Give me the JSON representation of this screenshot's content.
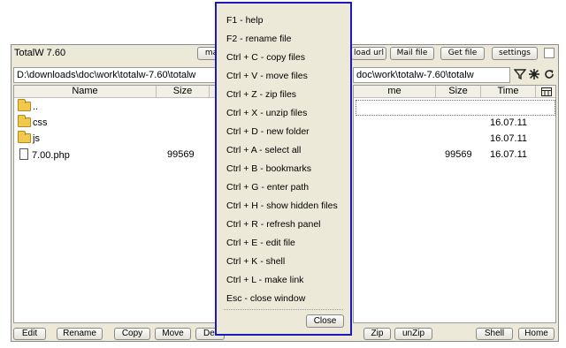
{
  "app": {
    "title": "TotalW 7.60"
  },
  "toolbar": {
    "partial_left": "ma",
    "download_url": "load url",
    "mail_file": "Mail file",
    "get_file": "Get file",
    "settings": "settings"
  },
  "left_panel": {
    "path": "D:\\downloads\\doc\\work\\totalw-7.60\\totalw",
    "columns": {
      "name": "Name",
      "size": "Size"
    },
    "rows": [
      {
        "name": "..",
        "type": "folder",
        "size": ""
      },
      {
        "name": "css",
        "type": "folder",
        "size": ""
      },
      {
        "name": "js",
        "type": "folder",
        "size": ""
      },
      {
        "name": "7.00.php",
        "type": "file",
        "size": "99569"
      }
    ]
  },
  "right_panel": {
    "path": "doc\\work\\totalw-7.60\\totalw",
    "columns": {
      "name": "me",
      "size": "Size",
      "time": "Time"
    },
    "rows": [
      {
        "size": "",
        "time": "16.07.11"
      },
      {
        "size": "",
        "time": "16.07.11"
      },
      {
        "size": "99569",
        "time": "16.07.11"
      }
    ]
  },
  "bottombar": {
    "edit": "Edit",
    "rename": "Rename",
    "copy": "Copy",
    "move": "Move",
    "delete_partial": "Del",
    "zip": "Zip",
    "unzip": "unZip",
    "shell": "Shell",
    "home": "Home"
  },
  "help_popup": {
    "items": [
      "F1 - help",
      "F2 - rename file",
      "Ctrl + C - copy files",
      "Ctrl + V - move files",
      "Ctrl + Z - zip files",
      "Ctrl + X - unzip files",
      "Ctrl + D - new folder",
      "Ctrl + A - select all",
      "Ctrl + B - bookmarks",
      "Ctrl + G - enter path",
      "Ctrl + H - show hidden files",
      "Ctrl + R - refresh panel",
      "Ctrl + E - edit file",
      "Ctrl + K - shell",
      "Ctrl + L - make link",
      "Esc - close window"
    ],
    "close_label": "Close"
  },
  "icons": {
    "filter": "filter-icon",
    "settings": "gear-icon",
    "refresh": "refresh-icon",
    "table": "table-icon"
  },
  "colors": {
    "popup_border": "#1a1ab8",
    "window_bg": "#ece9d8"
  }
}
